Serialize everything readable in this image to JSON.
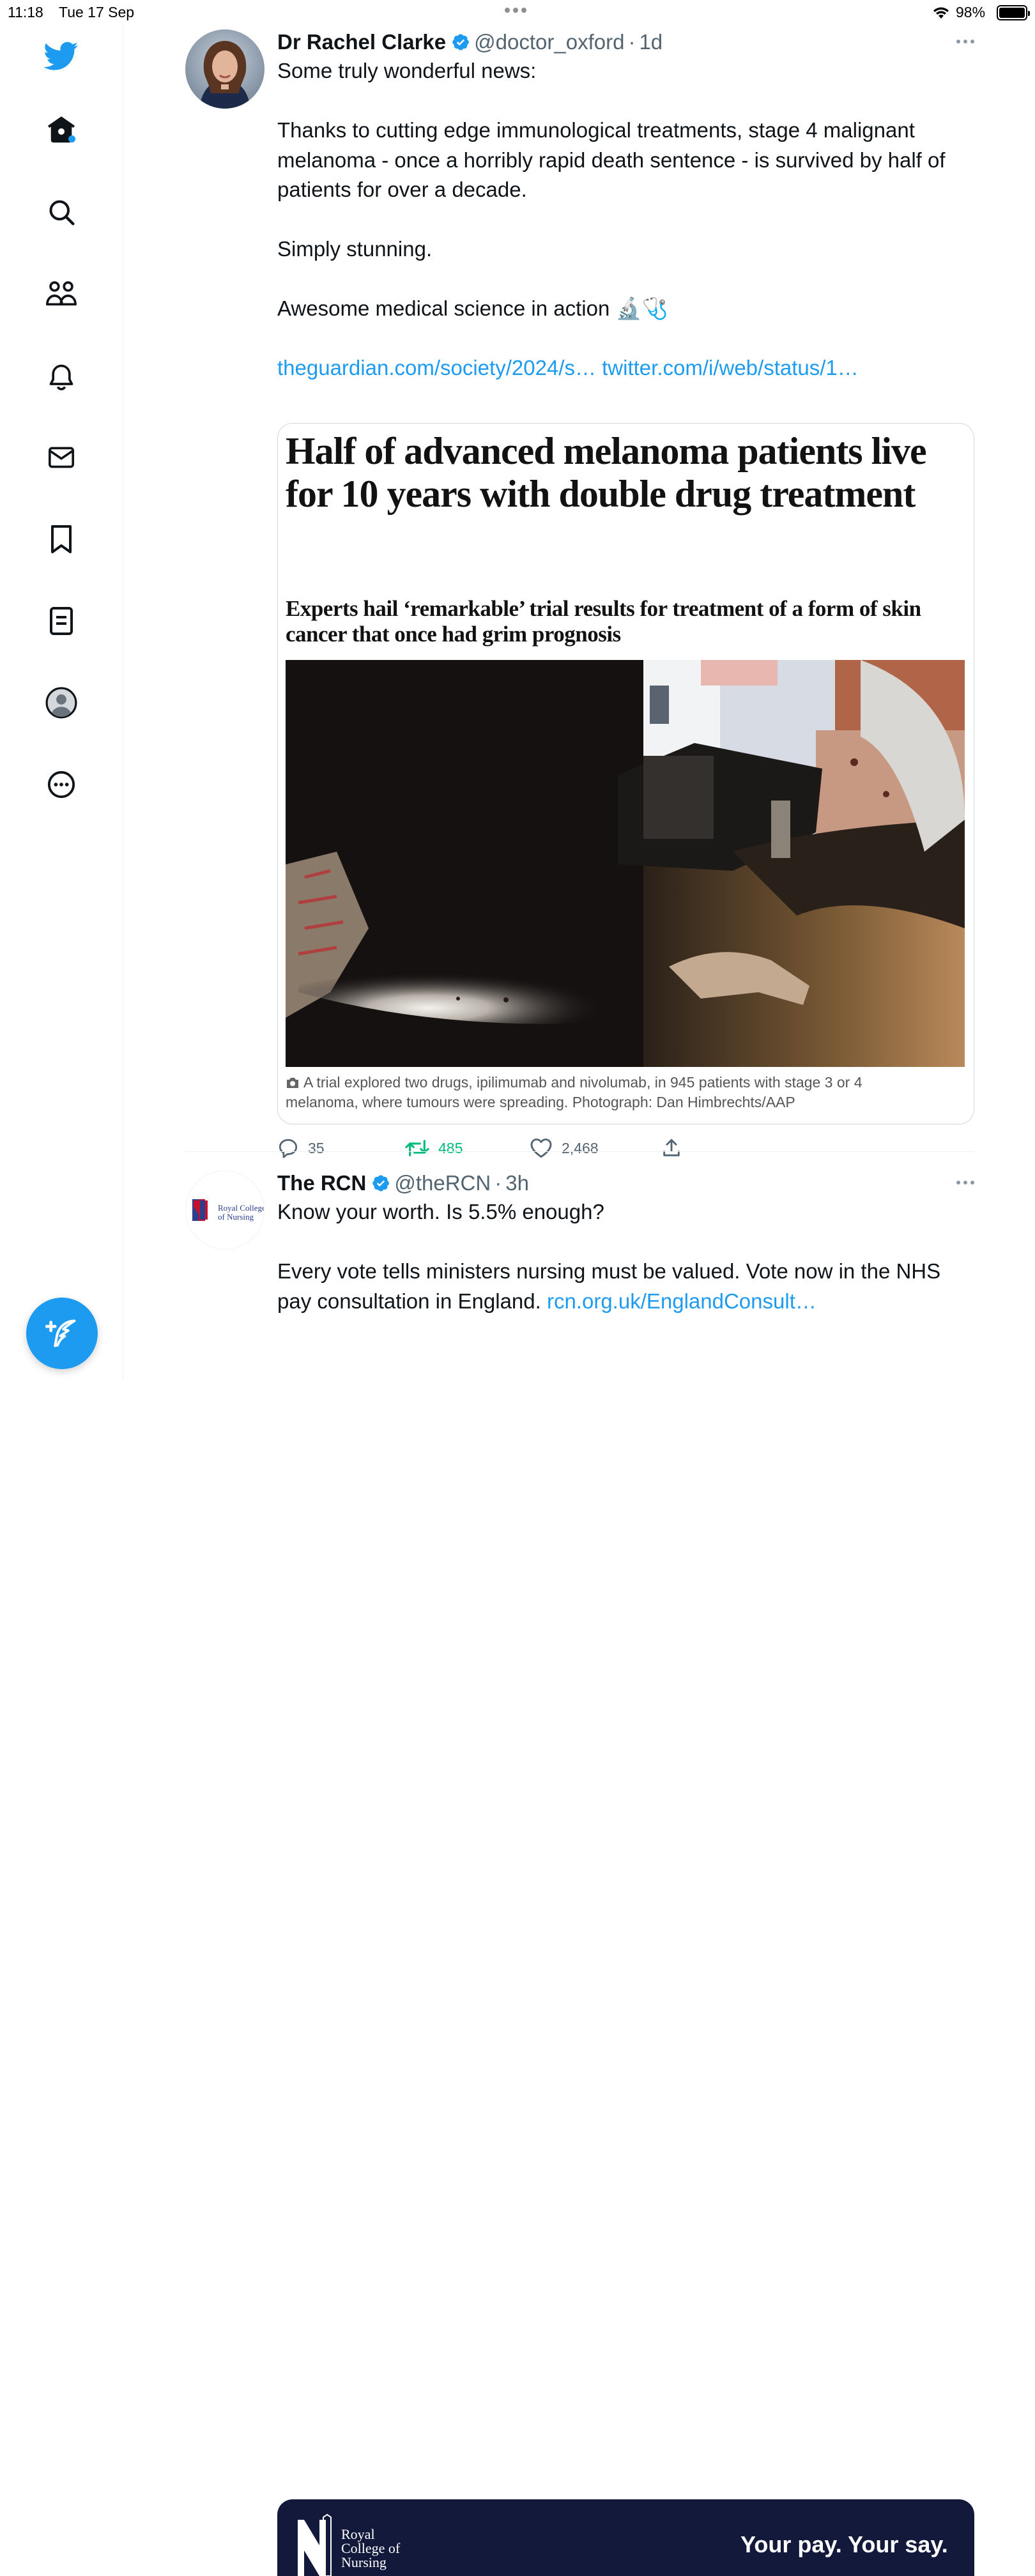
{
  "status_bar": {
    "time": "11:18",
    "date": "Tue 17 Sep",
    "battery": "98%"
  },
  "sidebar": {
    "items": [
      {
        "icon": "twitter-bird-icon"
      },
      {
        "icon": "home-icon"
      },
      {
        "icon": "search-icon"
      },
      {
        "icon": "communities-icon"
      },
      {
        "icon": "notifications-bell-icon"
      },
      {
        "icon": "messages-envelope-icon"
      },
      {
        "icon": "bookmark-icon"
      },
      {
        "icon": "lists-icon"
      },
      {
        "icon": "profile-avatar-icon"
      },
      {
        "icon": "more-circle-icon"
      }
    ],
    "compose_icon": "compose-feather-icon"
  },
  "colors": {
    "accent": "#1d9bf0",
    "retweet": "#00ba7c",
    "secondary_text": "#536471"
  },
  "tweets": [
    {
      "author": "Dr Rachel Clarke",
      "handle": "@doctor_oxford",
      "time": "1d",
      "text_lines": [
        "Some truly wonderful news:",
        "",
        "Thanks to cutting edge immunological treatments, stage 4 malignant melanoma - once a horribly rapid death sentence - is survived by half of patients for over a decade.",
        "",
        "Simply stunning.",
        "",
        "Awesome medical science in action 🔬🩺"
      ],
      "links": [
        "theguardian.com/society/2024/s…",
        "twitter.com/i/web/status/1…"
      ],
      "card": {
        "headline": "Half of advanced melanoma patients live for 10 years with double drug treatment",
        "standfirst": "Experts hail ‘remarkable’ trial results for treatment of a form of skin cancer that once had grim prognosis",
        "caption": "A trial explored two drugs, ipilimumab and nivolumab, in 945 patients with stage 3 or 4 melanoma, where tumours were spreading. Photograph: Dan Himbrechts/AAP"
      },
      "actions": {
        "replies": "35",
        "retweets": "485",
        "likes": "2,468"
      }
    },
    {
      "author": "The RCN",
      "handle": "@theRCN",
      "time": "3h",
      "text_line1": "Know your worth. Is 5.5% enough?",
      "text_line2": "Every vote tells ministers nursing must be valued. Vote now in the NHS pay consultation in England.",
      "link": "rcn.org.uk/EnglandConsult…",
      "avatar_text": "Royal College of Nursing",
      "banner": {
        "logo_text": "Royal College of Nursing",
        "tagline": "Your pay. Your say."
      }
    }
  ]
}
